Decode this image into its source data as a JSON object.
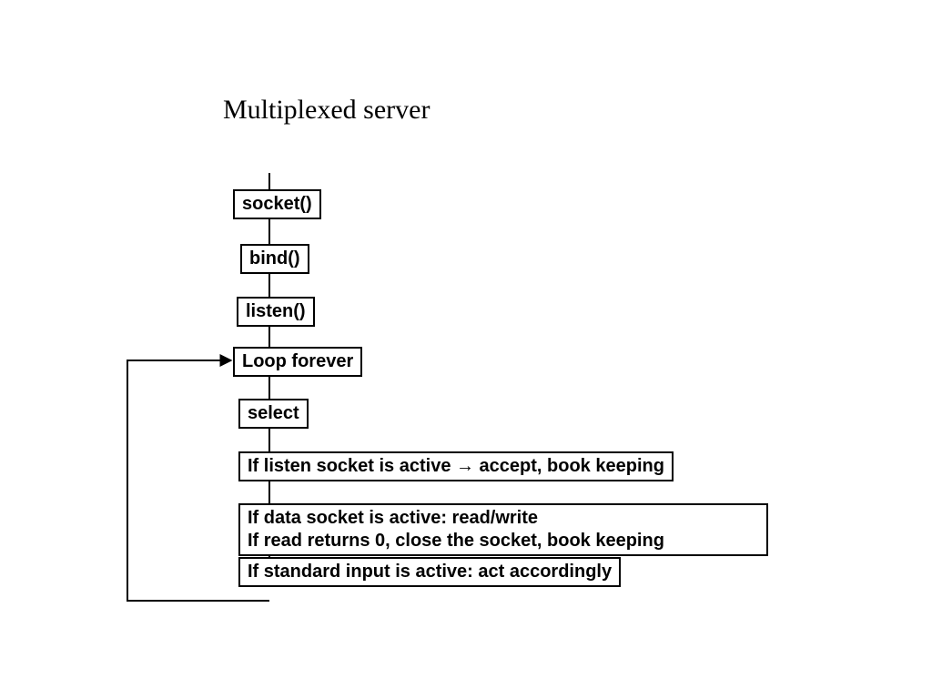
{
  "title": "Multiplexed server",
  "boxes": {
    "socket": "socket()",
    "bind": "bind()",
    "listen": "listen()",
    "loop": "Loop forever",
    "select": "select",
    "accept": "If listen socket is active → accept, book keeping",
    "data_line1": "If data socket is active: read/write",
    "data_line2": "If read returns 0, close the socket, book keeping",
    "stdin": "If standard input is active: act accordingly"
  },
  "chart_data": {
    "type": "flowchart",
    "title": "Multiplexed server",
    "nodes": [
      {
        "id": "socket",
        "label": "socket()"
      },
      {
        "id": "bind",
        "label": "bind()"
      },
      {
        "id": "listen",
        "label": "listen()"
      },
      {
        "id": "loop",
        "label": "Loop forever"
      },
      {
        "id": "select",
        "label": "select"
      },
      {
        "id": "accept",
        "label": "If listen socket is active → accept, book keeping"
      },
      {
        "id": "data",
        "label": "If data socket is active: read/write\nIf read returns 0, close the socket, book keeping"
      },
      {
        "id": "stdin",
        "label": "If standard input is active: act accordingly"
      }
    ],
    "edges": [
      {
        "from": "socket",
        "to": "bind"
      },
      {
        "from": "bind",
        "to": "listen"
      },
      {
        "from": "listen",
        "to": "loop"
      },
      {
        "from": "loop",
        "to": "select"
      },
      {
        "from": "select",
        "to": "accept"
      },
      {
        "from": "accept",
        "to": "data"
      },
      {
        "from": "data",
        "to": "stdin"
      },
      {
        "from": "stdin",
        "to": "loop",
        "kind": "loop-back"
      }
    ]
  }
}
